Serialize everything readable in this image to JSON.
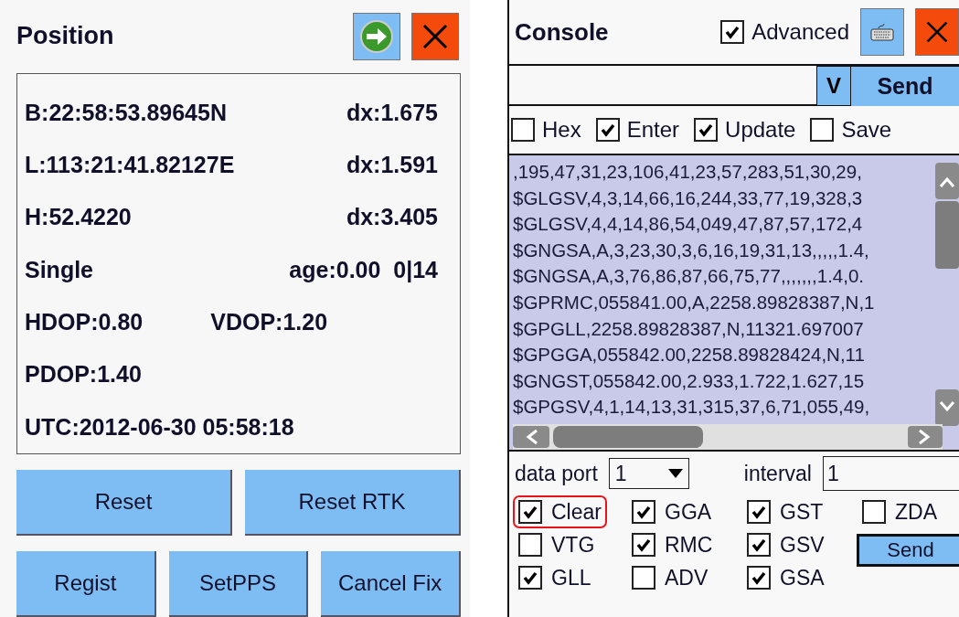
{
  "position": {
    "title": "Position",
    "rows": [
      {
        "kind": "pair",
        "left": "B:22:58:53.89645N",
        "right": "dx:1.675"
      },
      {
        "kind": "pair",
        "left": "L:113:21:41.82127E",
        "right": "dx:1.591"
      },
      {
        "kind": "pair",
        "left": "H:52.4220",
        "right": "dx:3.405"
      },
      {
        "kind": "pair",
        "left": "Single",
        "right": "age:0.00  0|14"
      },
      {
        "kind": "split",
        "left": "HDOP:0.80",
        "right": "VDOP:1.20"
      },
      {
        "kind": "single",
        "left": "PDOP:1.40"
      },
      {
        "kind": "single",
        "left": "UTC:2012-06-30 05:58:18"
      }
    ],
    "buttons_top": [
      "Reset",
      "Reset RTK"
    ],
    "buttons_bottom": [
      "Regist",
      "SetPPS",
      "Cancel Fix"
    ]
  },
  "console": {
    "title": "Console",
    "advanced": {
      "label": "Advanced",
      "checked": true
    },
    "command": {
      "dropdown": "V",
      "send": "Send"
    },
    "options": [
      {
        "label": "Hex",
        "checked": false
      },
      {
        "label": "Enter",
        "checked": true
      },
      {
        "label": "Update",
        "checked": true
      },
      {
        "label": "Save",
        "checked": false
      }
    ],
    "lines": [
      ",195,47,31,23,106,41,23,57,283,51,30,29,",
      "$GLGSV,4,3,14,66,16,244,33,77,19,328,3",
      "$GLGSV,4,4,14,86,54,049,47,87,57,172,4",
      "$GNGSA,A,3,23,30,3,6,16,19,31,13,,,,,1.4,",
      "$GNGSA,A,3,76,86,87,66,75,77,,,,,,,1.4,0.",
      "$GPRMC,055841.00,A,2258.89828387,N,1",
      "$GPGLL,2258.89828387,N,11321.697007",
      "$GPGGA,055842.00,2258.89828424,N,11",
      "$GNGST,055842.00,2.933,1.722,1.627,15",
      "$GPGSV,4,1,14,13,31,315,37,6,71,055,49,"
    ],
    "data_port": {
      "label": "data port",
      "value": "1"
    },
    "interval": {
      "label": "interval",
      "value": "1"
    },
    "messages": [
      {
        "label": "Clear",
        "checked": true,
        "highlighted": true
      },
      {
        "label": "GGA",
        "checked": true,
        "highlighted": false
      },
      {
        "label": "GST",
        "checked": true,
        "highlighted": false
      },
      {
        "label": "ZDA",
        "checked": false,
        "highlighted": false
      },
      {
        "label": "VTG",
        "checked": false,
        "highlighted": false
      },
      {
        "label": "RMC",
        "checked": true,
        "highlighted": false
      },
      {
        "label": "GSV",
        "checked": true,
        "highlighted": false
      },
      {
        "label": "GLL",
        "checked": true,
        "highlighted": false
      },
      {
        "label": "ADV",
        "checked": false,
        "highlighted": false
      },
      {
        "label": "GSA",
        "checked": true,
        "highlighted": false
      }
    ],
    "send_button": "Send"
  }
}
